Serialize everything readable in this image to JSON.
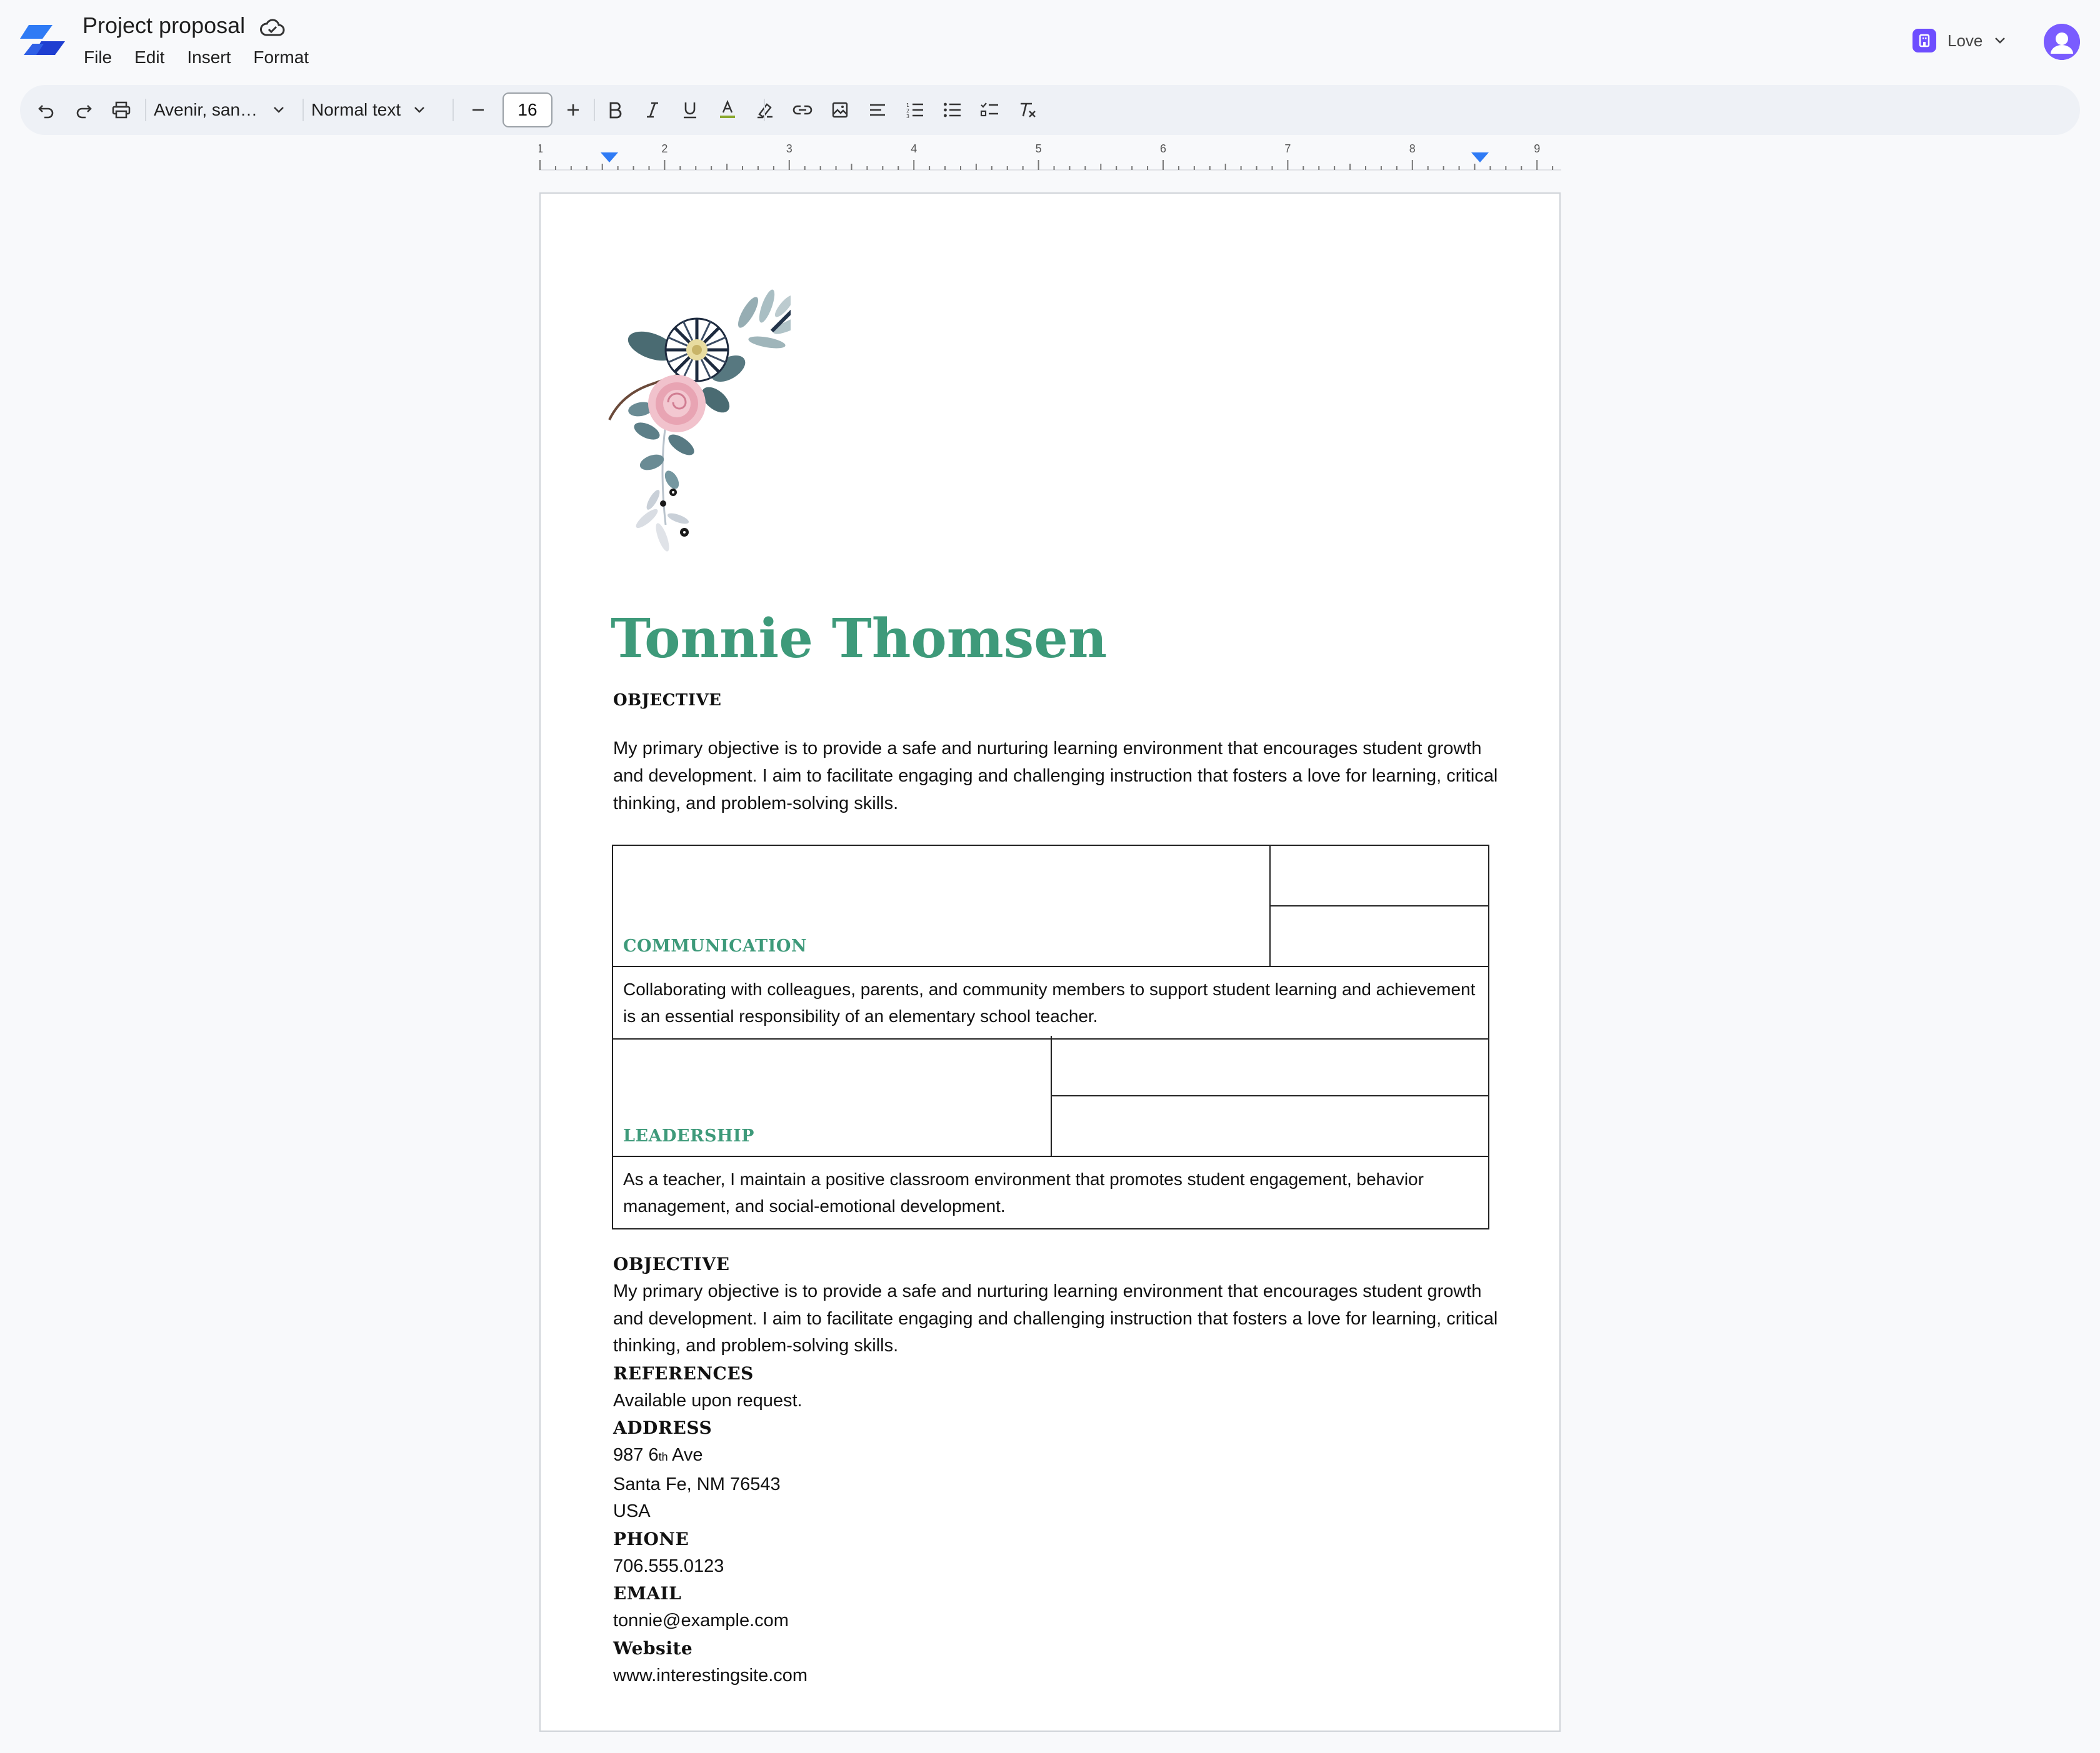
{
  "app": {
    "doc_title": "Project proposal",
    "menu": [
      "File",
      "Edit",
      "Insert",
      "Format"
    ],
    "account_name": "Love"
  },
  "toolbar": {
    "font_family": "Avenir, san…",
    "paragraph_style": "Normal text",
    "font_size": "16"
  },
  "ruler": {
    "labels": [
      "1",
      "2",
      "3",
      "4",
      "5",
      "6",
      "7",
      "8",
      "9"
    ]
  },
  "document": {
    "name": "Tonnie Thomsen",
    "objective_heading": "OBJECTIVE",
    "objective_text": "My primary objective is to provide a safe and nurturing learning environment that encourages student growth and development. I aim to facilitate engaging and challenging instruction that fosters a love for learning, critical thinking, and problem-solving skills.",
    "skills": [
      {
        "label": "COMMUNICATION",
        "text": "Collaborating with colleagues, parents, and community members to support student learning and achievement is an essential responsibility of an elementary school teacher."
      },
      {
        "label": "LEADERSHIP",
        "text": "As a teacher, I maintain a positive classroom environment that promotes student engagement, behavior management, and social-emotional development."
      }
    ],
    "objective2_heading": "OBJECTIVE",
    "objective2_text": "My primary objective is to provide a safe and nurturing learning environment that encourages student growth and development. I aim to facilitate engaging and challenging instruction that fosters a love for learning, critical thinking, and problem-solving skills.",
    "references_heading": "REFERENCES",
    "references_text": "Available upon request.",
    "address_heading": "ADDRESS",
    "address_line1_num": "987 6",
    "address_line1_sup": "th",
    "address_line1_rest": " Ave",
    "address_line2": "Santa Fe, NM 76543",
    "address_line3": "USA",
    "phone_heading": "PHONE",
    "phone": "706.555.0123",
    "email_heading": "EMAIL",
    "email": "tonnie@example.com",
    "website_heading": "Website",
    "website": "www.interestingsite.com"
  },
  "colors": {
    "accent_green": "#3e9a7a",
    "brand_blue": "#2f54eb",
    "account_purple": "#6d4dff"
  }
}
